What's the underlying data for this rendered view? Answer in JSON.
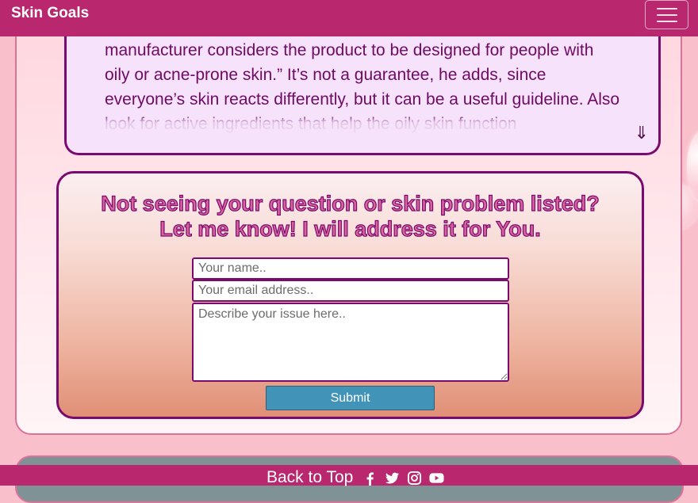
{
  "navbar": {
    "brand": "Skin Goals",
    "toggler_icon": "hamburger-menu-icon"
  },
  "article": {
    "paragraph": "manufacturer considers the product to be designed for people with oily or acne-prone skin.” It’s not a guarantee, he adds, since everyone’s skin reacts differently, but it can be a useful guideline. Also look for active ingredients that help the oily skin function",
    "scroll_icon": "double-arrow-down-icon",
    "scroll_glyph": "⇓"
  },
  "contact_form": {
    "heading_line1": "Not seeing your question or skin problem listed?",
    "heading_line2": "Let me know! I will address it for You.",
    "name_placeholder": "Your name..",
    "email_placeholder": "Your email address..",
    "issue_placeholder": "Describe your issue here..",
    "submit_label": "Submit"
  },
  "footer": {
    "back_to_top": "Back to Top",
    "social_icons": [
      "facebook-icon",
      "twitter-icon",
      "instagram-icon",
      "youtube-icon"
    ]
  },
  "colors": {
    "primary": "#b9286f",
    "border_purple": "#7a0a6e",
    "submit_blue": "#4293b8",
    "page_pink": "#f9bfcb"
  }
}
